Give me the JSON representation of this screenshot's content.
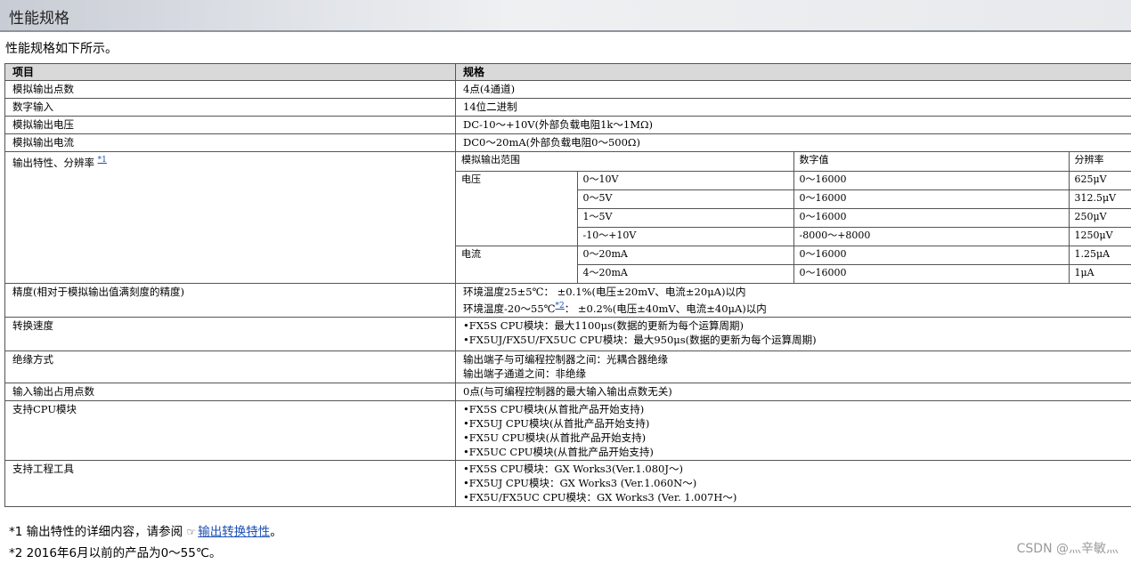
{
  "header": {
    "title": "性能规格"
  },
  "intro": "性能规格如下所示。",
  "table": {
    "col_item": "项目",
    "col_spec": "规格",
    "rows": {
      "outputs": {
        "item": "模拟输出点数",
        "spec": "4点(4通道)"
      },
      "digital_input": {
        "item": "数字输入",
        "spec": "14位二进制"
      },
      "voltage_out": {
        "item": "模拟输出电压",
        "spec": "DC-10～+10V(外部负载电阻1k～1MΩ)"
      },
      "current_out": {
        "item": "模拟输出电流",
        "spec": "DC0～20mA(外部负载电阻0～500Ω)"
      },
      "characteristics": {
        "item": "输出特性、分辨率",
        "ref": "*1",
        "headers": {
          "range": "模拟输出范围",
          "digital": "数字值",
          "resolution": "分辨率"
        },
        "voltage_label": "电压",
        "current_label": "电流",
        "voltage_rows": [
          {
            "range": "0～10V",
            "digital": "0～16000",
            "resolution": "625μV"
          },
          {
            "range": "0～5V",
            "digital": "0～16000",
            "resolution": "312.5μV"
          },
          {
            "range": "1～5V",
            "digital": "0～16000",
            "resolution": "250μV"
          },
          {
            "range": "-10～+10V",
            "digital": "-8000～+8000",
            "resolution": "1250μV"
          }
        ],
        "current_rows": [
          {
            "range": "0～20mA",
            "digital": "0～16000",
            "resolution": "1.25μA"
          },
          {
            "range": "4～20mA",
            "digital": "0～16000",
            "resolution": "1μA"
          }
        ]
      },
      "accuracy": {
        "item": "精度(相对于模拟输出值满刻度的精度)",
        "line1": "环境温度25±5℃： ±0.1%(电压±20mV、电流±20μA)以内",
        "line2_pre": "环境温度-20～55℃",
        "line2_ref": "*2",
        "line2_post": "： ±0.2%(电压±40mV、电流±40μA)以内"
      },
      "speed": {
        "item": "转换速度",
        "line1": "•FX5S CPU模块：最大1100μs(数据的更新为每个运算周期)",
        "line2": "•FX5UJ/FX5U/FX5UC CPU模块：最大950μs(数据的更新为每个运算周期)"
      },
      "isolation": {
        "item": "绝缘方式",
        "line1": "输出端子与可编程控制器之间：光耦合器绝缘",
        "line2": "输出端子通道之间：非绝缘"
      },
      "io_points": {
        "item": "输入输出占用点数",
        "spec": "0点(与可编程控制器的最大输入输出点数无关)"
      },
      "cpu": {
        "item": "支持CPU模块",
        "lines": [
          "•FX5S CPU模块(从首批产品开始支持)",
          "•FX5UJ CPU模块(从首批产品开始支持)",
          "•FX5U CPU模块(从首批产品开始支持)",
          "•FX5UC CPU模块(从首批产品开始支持)"
        ]
      },
      "tools": {
        "item": "支持工程工具",
        "lines": [
          "•FX5S CPU模块：GX Works3(Ver.1.080J～)",
          "•FX5UJ CPU模块：GX Works3 (Ver.1.060N～)",
          "•FX5U/FX5UC CPU模块：GX Works3 (Ver. 1.007H～)"
        ]
      }
    }
  },
  "footnotes": {
    "n1_pre": "*1 输出特性的详细内容，请参阅",
    "n1_link": "输出转换特性",
    "n1_post": "。",
    "n2": "*2 2016年6月以前的产品为0～55℃。"
  },
  "watermark": "CSDN @灬辛敏灬"
}
